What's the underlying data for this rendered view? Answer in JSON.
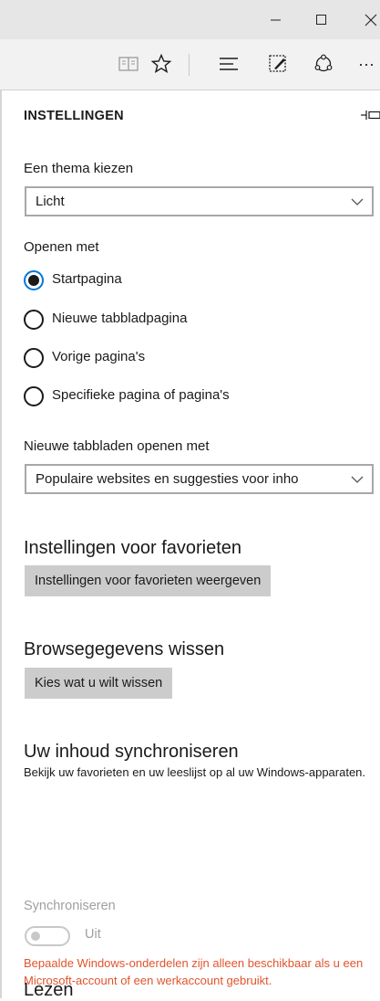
{
  "window": {
    "controls": {
      "minimize_icon": "minimize-icon",
      "maximize_icon": "maximize-icon",
      "close_icon": "close-icon"
    }
  },
  "toolbar": {
    "icons": [
      "reading-view-icon",
      "favorites-star-icon",
      "hub-icon",
      "web-note-icon",
      "share-icon",
      "more-icon"
    ],
    "more_label": "···"
  },
  "settings": {
    "header": "INSTELLINGEN",
    "theme": {
      "label": "Een thema kiezen",
      "selected": "Licht"
    },
    "open_with": {
      "label": "Openen met",
      "options": [
        {
          "label": "Startpagina",
          "selected": true
        },
        {
          "label": "Nieuwe tabbladpagina",
          "selected": false
        },
        {
          "label": "Vorige pagina's",
          "selected": false
        },
        {
          "label": "Specifieke pagina of pagina's",
          "selected": false
        }
      ]
    },
    "new_tabs": {
      "label": "Nieuwe tabbladen openen met",
      "selected": "Populaire websites en suggesties voor inho"
    },
    "favorites": {
      "heading": "Instellingen voor favorieten",
      "button": "Instellingen voor favorieten weergeven"
    },
    "clear": {
      "heading": "Browsegegevens wissen",
      "button": "Kies wat u wilt wissen"
    },
    "sync": {
      "heading": "Uw inhoud synchroniseren",
      "description": "Bekijk uw favorieten en uw leeslijst op al uw Windows-apparaten.",
      "toggle_label": "Synchroniseren",
      "toggle_state": "Uit",
      "warning": "Bepaalde Windows-onderdelen zijn alleen beschikbaar als u een Microsoft-account of een werkaccount gebruikt."
    },
    "reading": {
      "heading": "Lezen"
    }
  },
  "colors": {
    "accent": "#0078d7",
    "warning": "#e0542d",
    "button_bg": "#cccccc",
    "disabled": "#a0a0a0"
  }
}
